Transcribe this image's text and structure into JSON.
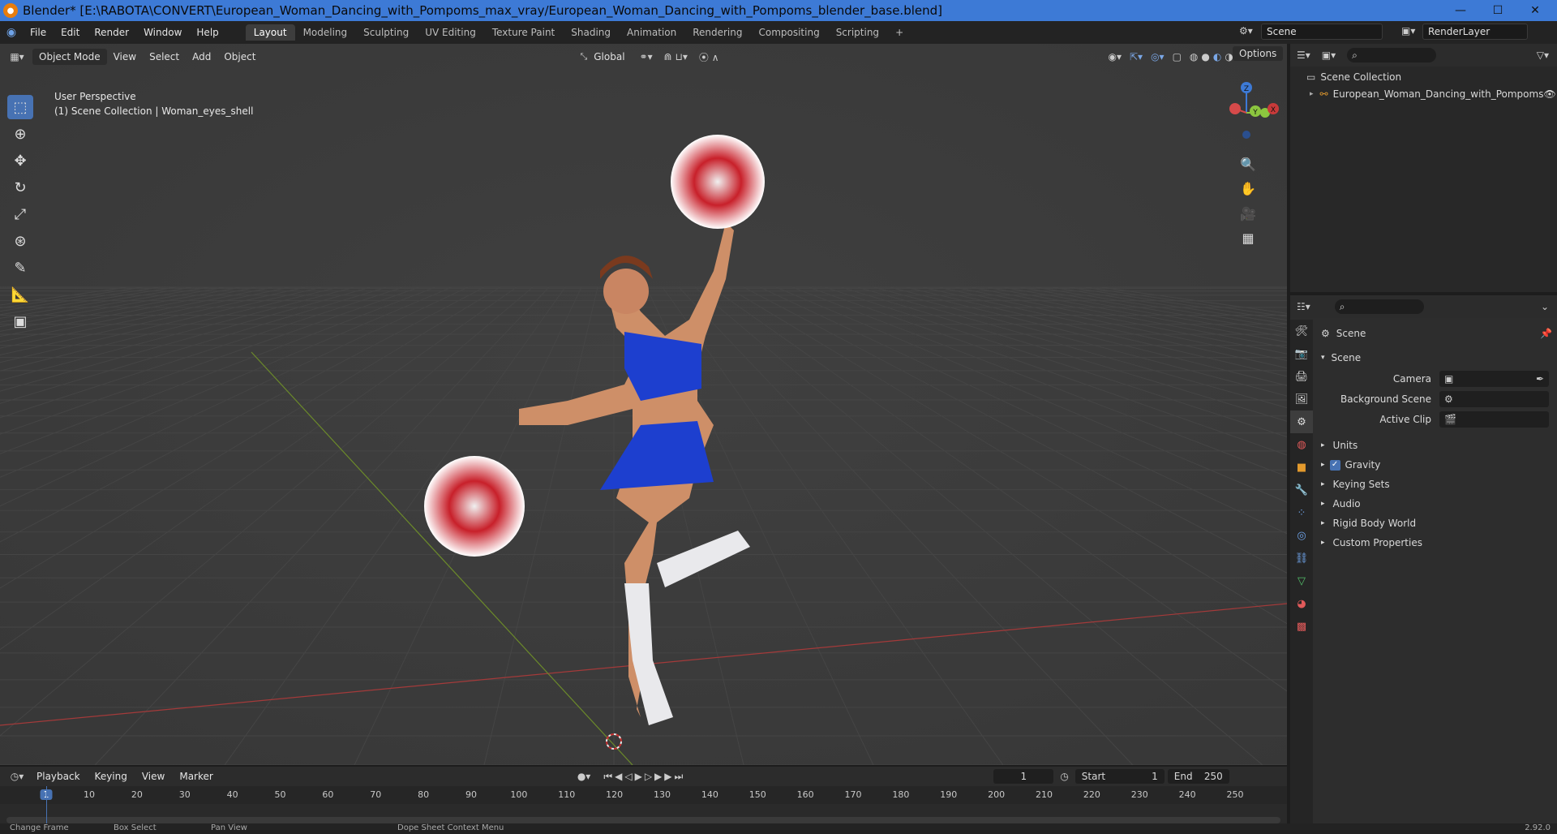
{
  "window": {
    "title": "Blender* [E:\\RABOTA\\CONVERT\\European_Woman_Dancing_with_Pompoms_max_vray/European_Woman_Dancing_with_Pompoms_blender_base.blend]",
    "minimize": "—",
    "maximize": "☐",
    "close": "✕"
  },
  "menu": [
    "File",
    "Edit",
    "Render",
    "Window",
    "Help"
  ],
  "workspaces": [
    "Layout",
    "Modeling",
    "Sculpting",
    "UV Editing",
    "Texture Paint",
    "Shading",
    "Animation",
    "Rendering",
    "Compositing",
    "Scripting"
  ],
  "add_workspace": "+",
  "scene_selector": "Scene",
  "renderlayer_selector": "RenderLayer",
  "viewport": {
    "mode": "Object Mode",
    "menus": [
      "View",
      "Select",
      "Add",
      "Object"
    ],
    "transform_orientation": "Global",
    "options": "Options",
    "perspective": "User Perspective",
    "collection_info": "(1) Scene Collection | Woman_eyes_shell",
    "gizmo_axes": {
      "x": "X",
      "y": "Y",
      "z": "Z"
    }
  },
  "outliner": {
    "root": "Scene Collection",
    "items": [
      "European_Woman_Dancing_with_Pompoms"
    ]
  },
  "properties": {
    "header": "Scene",
    "panel": "Scene",
    "fields": [
      {
        "label": "Camera",
        "value": ""
      },
      {
        "label": "Background Scene",
        "value": ""
      },
      {
        "label": "Active Clip",
        "value": ""
      }
    ],
    "sections": [
      {
        "label": "Units",
        "checkbox": false
      },
      {
        "label": "Gravity",
        "checkbox": true
      },
      {
        "label": "Keying Sets",
        "checkbox": false
      },
      {
        "label": "Audio",
        "checkbox": false
      },
      {
        "label": "Rigid Body World",
        "checkbox": false
      },
      {
        "label": "Custom Properties",
        "checkbox": false
      }
    ]
  },
  "timeline": {
    "menus": [
      "Playback",
      "Keying",
      "View",
      "Marker"
    ],
    "current_frame": "1",
    "start_label": "Start",
    "start": "1",
    "end_label": "End",
    "end": "250",
    "ticks": [
      "1",
      "10",
      "20",
      "30",
      "40",
      "50",
      "60",
      "70",
      "80",
      "90",
      "100",
      "110",
      "120",
      "130",
      "140",
      "150",
      "160",
      "170",
      "180",
      "190",
      "200",
      "210",
      "220",
      "230",
      "240",
      "250"
    ]
  },
  "statusbar": {
    "items": [
      "Change Frame",
      "Box Select",
      "Pan View",
      "Dope Sheet Context Menu"
    ],
    "version": "2.92.0"
  }
}
